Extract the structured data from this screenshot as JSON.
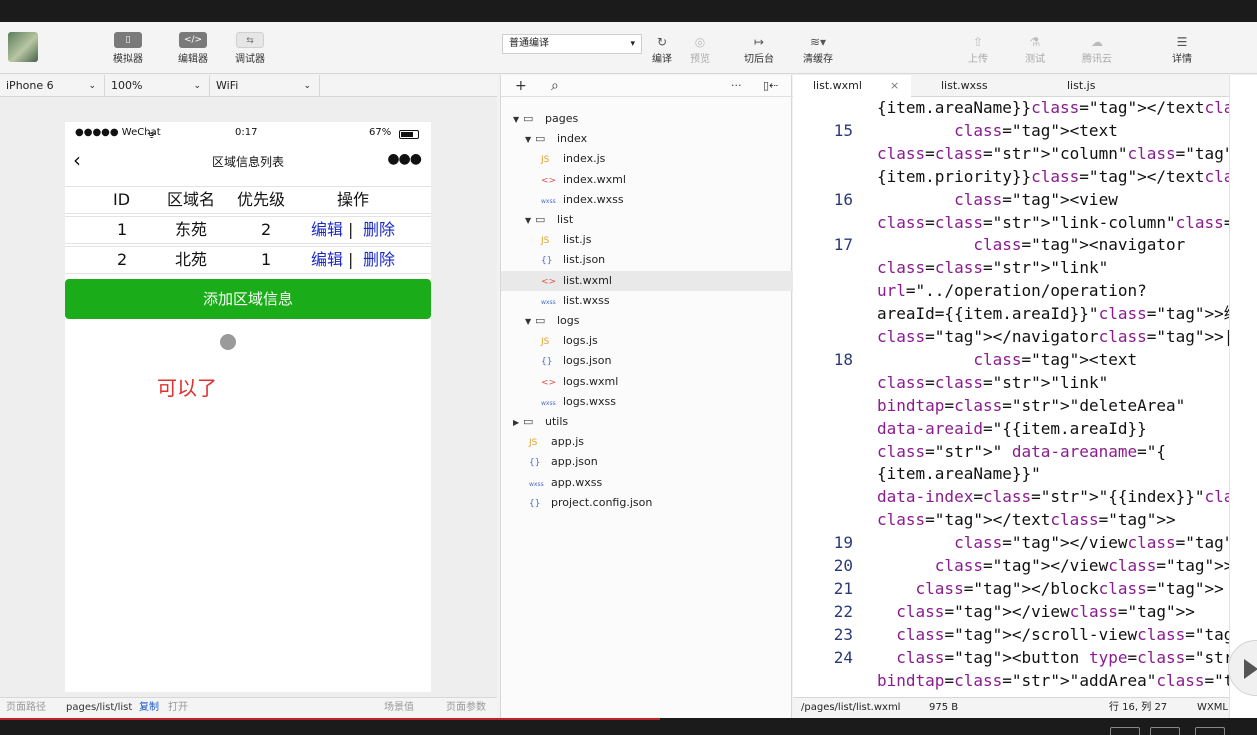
{
  "toolbar": {
    "simulator": "模拟器",
    "editor": "编辑器",
    "debugger": "调试器",
    "compile_mode": "普通编译",
    "compile": "编译",
    "preview": "预览",
    "backend": "切后台",
    "clear_cache": "清缓存",
    "upload": "上传",
    "test": "测试",
    "tencent_cloud": "腾讯云",
    "details": "详情"
  },
  "device_bar": {
    "device": "iPhone 6",
    "zoom": "100%",
    "network": "WiFi"
  },
  "phone": {
    "carrier": "●●●●● WeChat",
    "time": "0:17",
    "battery": "67%",
    "title": "区域信息列表",
    "headers": [
      "ID",
      "区域名",
      "优先级",
      "操作"
    ],
    "rows": [
      {
        "id": "1",
        "name": "东苑",
        "priority": "2",
        "edit": "编辑",
        "sep": "|",
        "delete": "删除"
      },
      {
        "id": "2",
        "name": "北苑",
        "priority": "1",
        "edit": "编辑",
        "sep": "|",
        "delete": "删除"
      }
    ],
    "add_button": "添加区域信息",
    "annotation": "可以了"
  },
  "sim_footer": {
    "path_label": "页面路径",
    "path": "pages/list/list",
    "copy": "复制",
    "open": "打开",
    "scene": "场景值",
    "params": "页面参数"
  },
  "file_tree": [
    {
      "name": "pages",
      "type": "folder",
      "open": true
    },
    {
      "name": "index",
      "type": "folder",
      "open": true
    },
    {
      "name": "index.js",
      "type": "js"
    },
    {
      "name": "index.wxml",
      "type": "xml"
    },
    {
      "name": "index.wxss",
      "type": "wxss"
    },
    {
      "name": "list",
      "type": "folder",
      "open": true
    },
    {
      "name": "list.js",
      "type": "js"
    },
    {
      "name": "list.json",
      "type": "json"
    },
    {
      "name": "list.wxml",
      "type": "xml",
      "selected": true
    },
    {
      "name": "list.wxss",
      "type": "wxss"
    },
    {
      "name": "logs",
      "type": "folder",
      "open": true
    },
    {
      "name": "logs.js",
      "type": "js"
    },
    {
      "name": "logs.json",
      "type": "json"
    },
    {
      "name": "logs.wxml",
      "type": "xml"
    },
    {
      "name": "logs.wxss",
      "type": "wxss"
    },
    {
      "name": "utils",
      "type": "folder",
      "open": false
    },
    {
      "name": "app.js",
      "type": "js"
    },
    {
      "name": "app.json",
      "type": "json"
    },
    {
      "name": "app.wxss",
      "type": "wxss"
    },
    {
      "name": "project.config.json",
      "type": "json"
    }
  ],
  "file_icons": {
    "js": "JS",
    "xml": "<>",
    "wxss": "wxss",
    "json": "{}"
  },
  "editor": {
    "tabs": [
      "list.wxml",
      "list.wxss",
      "list.js"
    ],
    "lines": [
      {
        "n": "",
        "t": "{item.areaName}}</text>"
      },
      {
        "n": "15",
        "t": "        <text"
      },
      {
        "n": "",
        "t": "class=\"column\">{"
      },
      {
        "n": "",
        "t": "{item.priority}}</text>"
      },
      {
        "n": "16",
        "t": "        <view"
      },
      {
        "n": "",
        "t": "class=\"link-column\">"
      },
      {
        "n": "17",
        "t": "          <navigator"
      },
      {
        "n": "",
        "t": "class=\"link\""
      },
      {
        "n": "",
        "t": "url=\"../operation/operation?"
      },
      {
        "n": "",
        "t": "areaId={{item.areaId}}\">编辑"
      },
      {
        "n": "",
        "t": "</navigator>|"
      },
      {
        "n": "18",
        "t": "          <text"
      },
      {
        "n": "",
        "t": "class=\"link\""
      },
      {
        "n": "",
        "t": "bindtap=\"deleteArea\""
      },
      {
        "n": "",
        "t": "data-areaid=\"{{item.areaId}}"
      },
      {
        "n": "",
        "t": "\" data-areaname=\"{"
      },
      {
        "n": "",
        "t": "{item.areaName}}\""
      },
      {
        "n": "",
        "t": "data-index=\"{{index}}\">删除"
      },
      {
        "n": "",
        "t": "</text>"
      },
      {
        "n": "19",
        "t": "        </view>"
      },
      {
        "n": "20",
        "t": "      </view>"
      },
      {
        "n": "21",
        "t": "    </block>"
      },
      {
        "n": "22",
        "t": "  </view>"
      },
      {
        "n": "23",
        "t": "  </scroll-view>"
      },
      {
        "n": "24",
        "t": "  <button type=\"primary\""
      },
      {
        "n": "",
        "t": "bindtap=\"addArea\">添加区域信息"
      }
    ],
    "footer_path": "/pages/list/list.wxml",
    "footer_size": "975 B",
    "footer_pos": "行 16, 列 27",
    "footer_lang": "WXML"
  }
}
